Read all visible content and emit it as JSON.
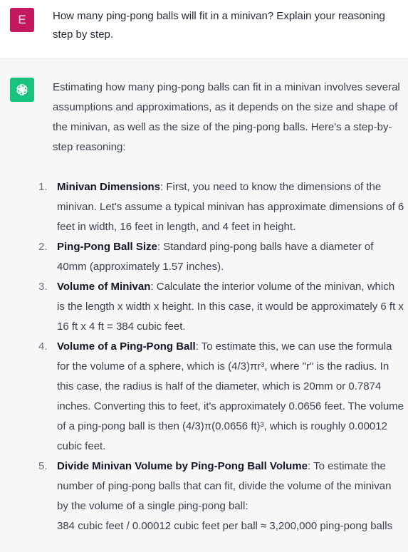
{
  "user": {
    "avatar_letter": "E",
    "avatar_color": "#c3185d",
    "message": "How many ping-pong balls will fit in a minivan? Explain your reasoning step by step."
  },
  "assistant": {
    "avatar_icon": "openai-logo-icon",
    "avatar_color": "#19c37d",
    "intro": "Estimating how many ping-pong balls can fit in a minivan involves several assumptions and approximations, as it depends on the size and shape of the minivan, as well as the size of the ping-pong balls. Here's a step-by-step reasoning:",
    "steps": [
      {
        "number": "1.",
        "title": "Minivan Dimensions",
        "text": ": First, you need to know the dimensions of the minivan. Let's assume a typical minivan has approximate dimensions of 6 feet in width, 16 feet in length, and 4 feet in height."
      },
      {
        "number": "2.",
        "title": "Ping-Pong Ball Size",
        "text": ": Standard ping-pong balls have a diameter of 40mm (approximately 1.57 inches)."
      },
      {
        "number": "3.",
        "title": "Volume of Minivan",
        "text": ": Calculate the interior volume of the minivan, which is the length x width x height. In this case, it would be approximately 6 ft x 16 ft x 4 ft = 384 cubic feet."
      },
      {
        "number": "4.",
        "title": "Volume of a Ping-Pong Ball",
        "text": ": To estimate this, we can use the formula for the volume of a sphere, which is (4/3)πr³, where \"r\" is the radius. In this case, the radius is half of the diameter, which is 20mm or 0.7874 inches. Converting this to feet, it's approximately 0.0656 feet. The volume of a ping-pong ball is then (4/3)π(0.0656 ft)³, which is roughly 0.00012 cubic feet."
      },
      {
        "number": "5.",
        "title": "Divide Minivan Volume by Ping-Pong Ball Volume",
        "text": ": To estimate the number of ping-pong balls that can fit, divide the volume of the minivan by the volume of a single ping-pong ball:",
        "formula": "384 cubic feet / 0.00012 cubic feet per ball ≈ 3,200,000 ping-pong balls"
      }
    ]
  }
}
